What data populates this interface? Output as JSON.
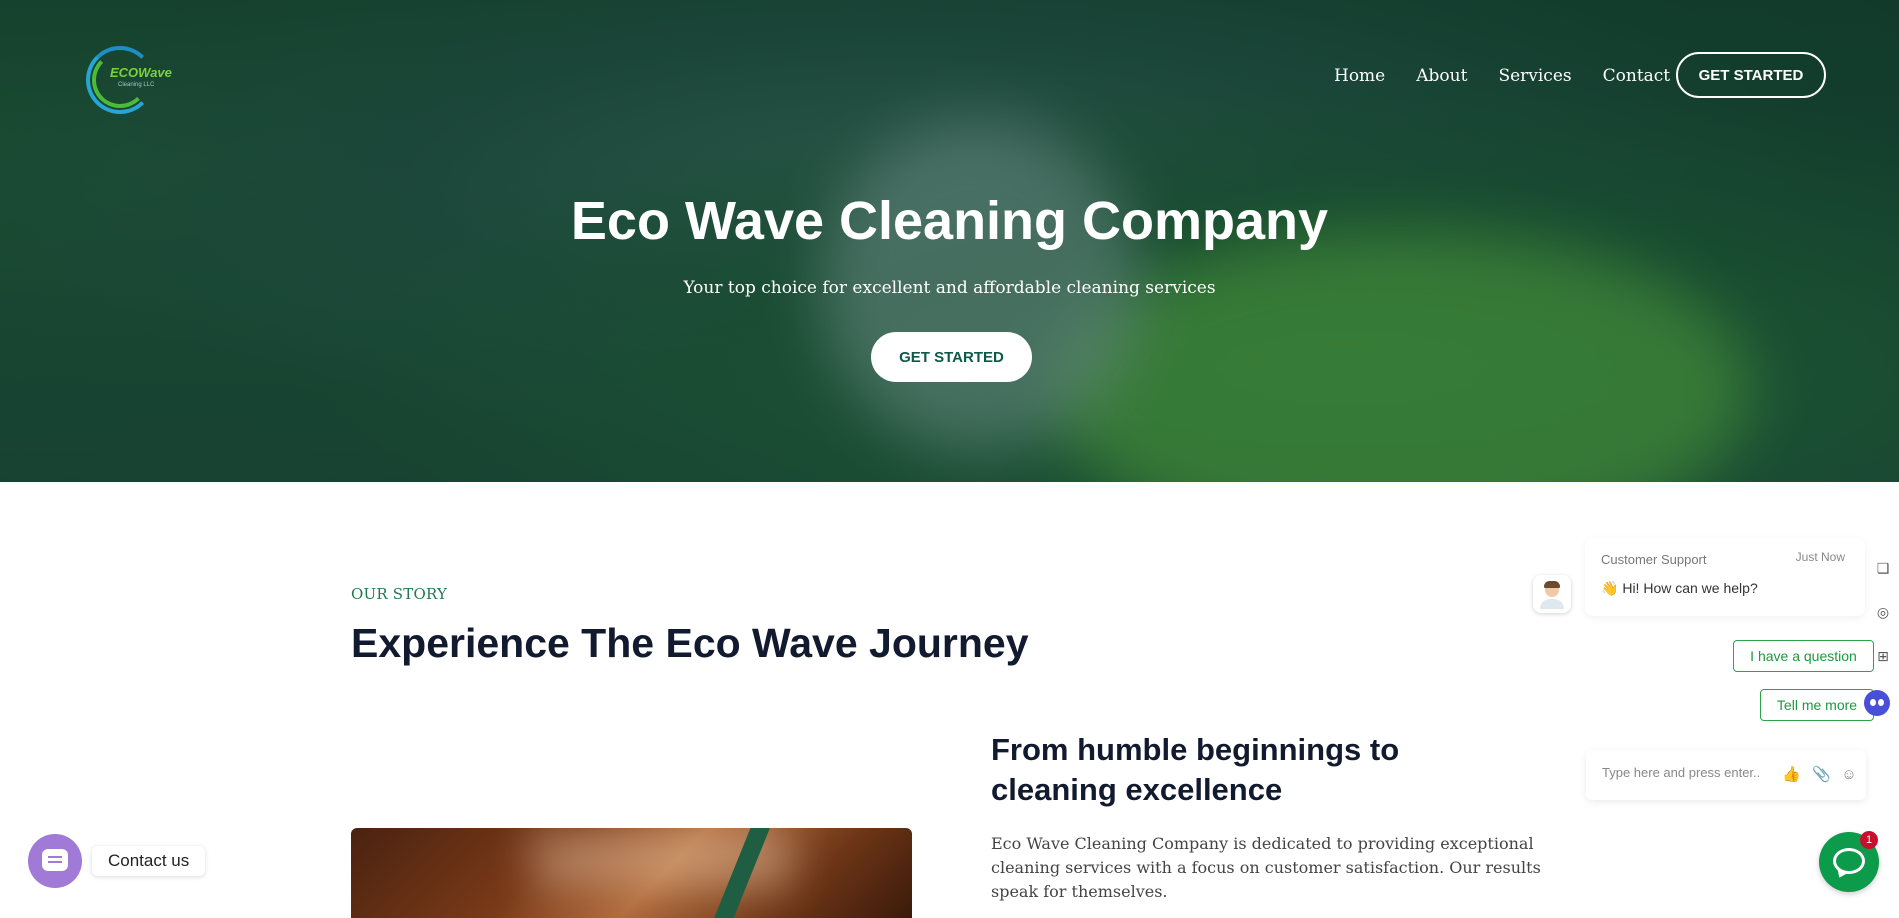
{
  "brand": {
    "logo_text": "ECOWave",
    "logo_sub": "Cleaning LLC"
  },
  "nav": {
    "items": [
      {
        "label": "Home"
      },
      {
        "label": "About"
      },
      {
        "label": "Services"
      },
      {
        "label": "Contact"
      }
    ],
    "cta": "GET STARTED"
  },
  "hero": {
    "title": "Eco Wave Cleaning Company",
    "subtitle": "Your top choice for excellent and affordable cleaning services",
    "cta": "GET STARTED"
  },
  "story": {
    "eyebrow": "OUR STORY",
    "title": "Experience The Eco Wave Journey",
    "subtitle": "From humble beginnings to cleaning excellence",
    "body": "Eco Wave Cleaning Company is dedicated to providing exceptional cleaning services with a focus on customer satisfaction. Our results speak for themselves."
  },
  "chat": {
    "agent": "Customer Support",
    "time": "Just Now",
    "greeting_emoji": "👋",
    "greeting": "Hi! How can we help?",
    "quick_replies": [
      "I have a question",
      "Tell me more"
    ],
    "input_placeholder": "Type here and press enter..",
    "badge_count": "1",
    "side_icons": [
      "book-icon",
      "podcast-icon",
      "apps-icon",
      "bot-icon"
    ]
  },
  "contact_widget": {
    "label": "Contact us"
  },
  "colors": {
    "accent": "#0c5a47",
    "chat_green": "#0c9a4b",
    "contact_purple": "#a07ad6",
    "badge_red": "#c8102e"
  }
}
